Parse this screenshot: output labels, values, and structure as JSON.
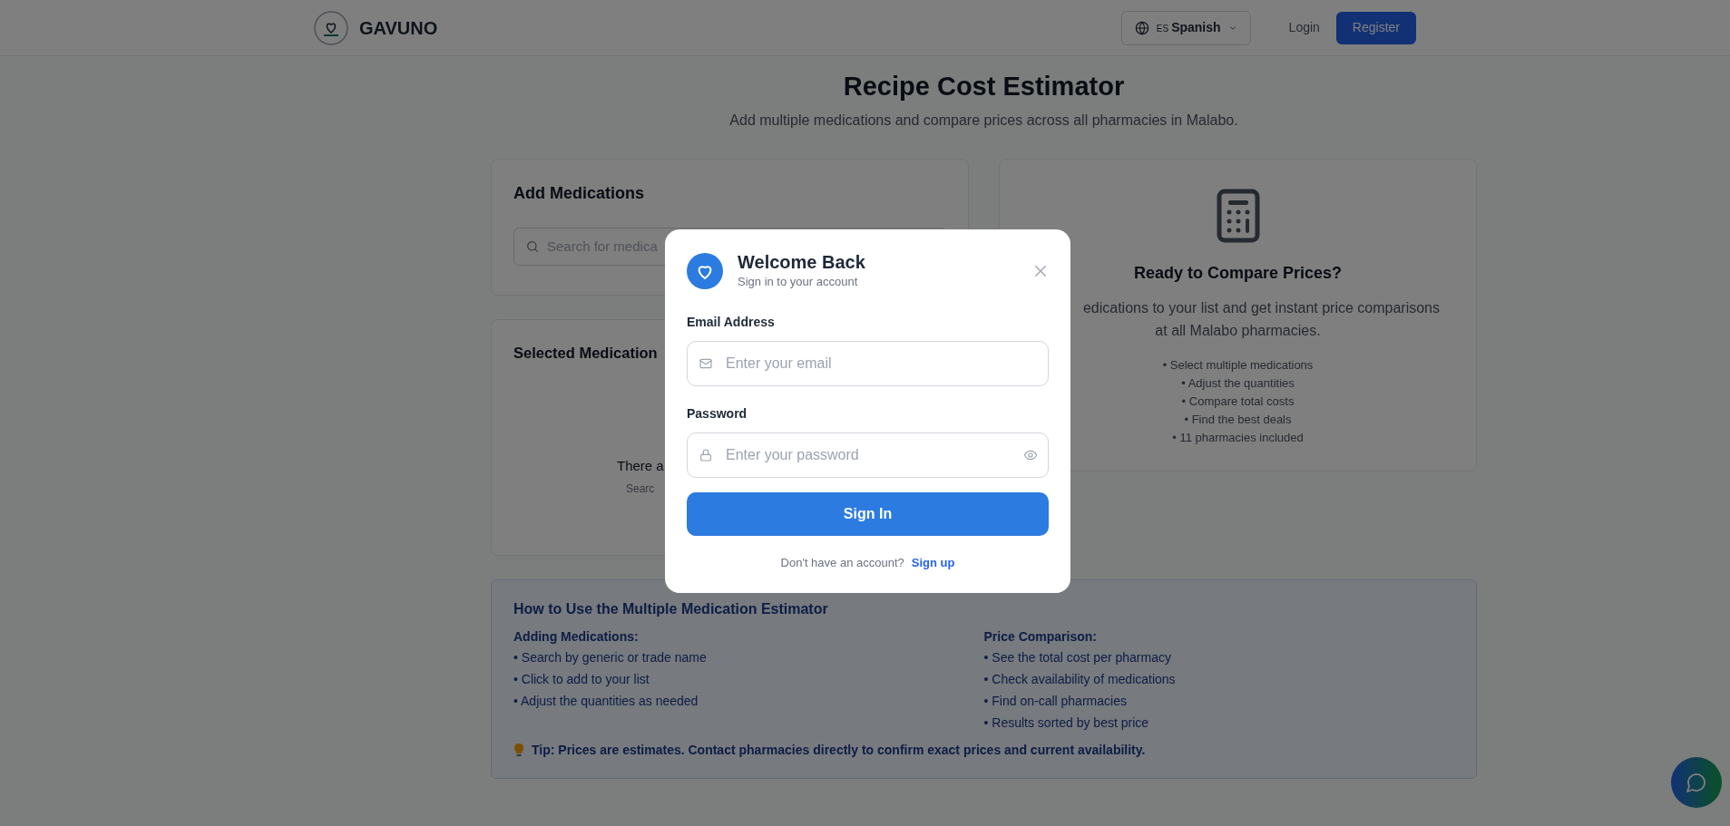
{
  "navbar": {
    "brand": "GAVUNO",
    "language": {
      "code": "ES",
      "label": "Spanish"
    },
    "actions": [
      {
        "label": "Login",
        "kind": "link"
      },
      {
        "label": "Register",
        "kind": "primary"
      }
    ]
  },
  "header": {
    "title": "Recipe Cost Estimator",
    "subtitle": "Add multiple medications and compare prices across all pharmacies in Malabo."
  },
  "add_card": {
    "title": "Add Medications",
    "search": {
      "placeholder": "Search for medica"
    }
  },
  "selected_card": {
    "title": "Selected Medication",
    "empty_text": "There a",
    "empty_hint": "Searc"
  },
  "compare_card": {
    "title": "Ready to Compare Prices?",
    "description": [
      "edications to your list and get instant price comparisons",
      "at all Malabo pharmacies."
    ],
    "features": [
      "• Select multiple medications",
      "• Adjust the quantities",
      "• Compare total costs",
      "• Find the best deals",
      "• 11 pharmacies included"
    ]
  },
  "help": {
    "title": "How to Use the Multiple Medication Estimator",
    "columns": [
      {
        "heading": "Adding Medications:",
        "items": [
          "• Search by generic or trade name",
          "• Click to add to your list",
          "• Adjust the quantities as needed"
        ]
      },
      {
        "heading": "Price Comparison:",
        "items": [
          "• See the total cost per pharmacy",
          "• Check availability of medications",
          "• Find on-call pharmacies",
          "• Results sorted by best price"
        ]
      }
    ],
    "tip": "Tip: Prices are estimates. Contact pharmacies directly to confirm exact prices and current availability."
  },
  "modal": {
    "title": "Welcome Back",
    "subtitle": "Sign in to your account",
    "fields": [
      {
        "kind": "email",
        "label": "Email Address",
        "placeholder": "Enter your email"
      },
      {
        "kind": "password",
        "label": "Password",
        "placeholder": "Enter your password"
      }
    ],
    "submit": "Sign In",
    "footer_text": "Don't have an account?",
    "footer_link": "Sign up"
  }
}
